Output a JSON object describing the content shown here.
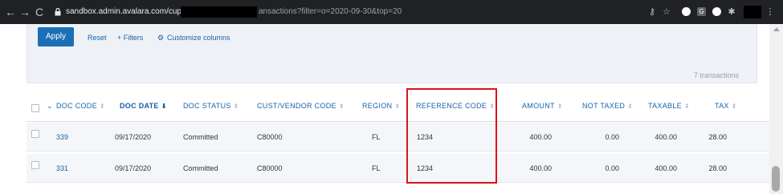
{
  "browser": {
    "back_glyph": "←",
    "forward_glyph": "→",
    "reload_glyph": "C",
    "url_left": "sandbox.admin.avalara.com/cup/a",
    "url_right": "ansactions?filter=o=2020-09-30&top=20",
    "key_glyph": "⚷",
    "star_glyph": "☆",
    "ext_g": "G",
    "puzzle_glyph": "✱",
    "menu_glyph": "⋮"
  },
  "filter": {
    "apply_label": "Apply",
    "reset_label": "Reset",
    "filters_label": "+ Filters",
    "customize_label": "Customize columns",
    "gear_glyph": "⚙"
  },
  "transactions_count": "7 transactions",
  "table": {
    "headers": {
      "doc_code": "DOC CODE",
      "doc_date": "DOC DATE",
      "doc_status": "DOC STATUS",
      "cust_vendor": "CUST/VENDOR CODE",
      "region": "REGION",
      "reference_code": "REFERENCE CODE",
      "amount": "AMOUNT",
      "not_taxed": "NOT TAXED",
      "taxable": "TAXABLE",
      "tax": "TAX"
    },
    "sort_glyph": "⬍",
    "sort_active_glyph": "⬇",
    "chevron_glyph": "⌄",
    "rows": [
      {
        "doc_code": "339",
        "doc_date": "09/17/2020",
        "doc_status": "Committed",
        "cust_vendor": "C80000",
        "region": "FL",
        "reference_code": "1234",
        "amount": "400.00",
        "not_taxed": "0.00",
        "taxable": "400.00",
        "tax": "28.00"
      },
      {
        "doc_code": "331",
        "doc_date": "09/17/2020",
        "doc_status": "Committed",
        "cust_vendor": "C80000",
        "region": "FL",
        "reference_code": "1234",
        "amount": "400.00",
        "not_taxed": "0.00",
        "taxable": "400.00",
        "tax": "28.00"
      }
    ]
  },
  "colors": {
    "accent": "#1c6fb7",
    "highlight": "#d9141c"
  }
}
